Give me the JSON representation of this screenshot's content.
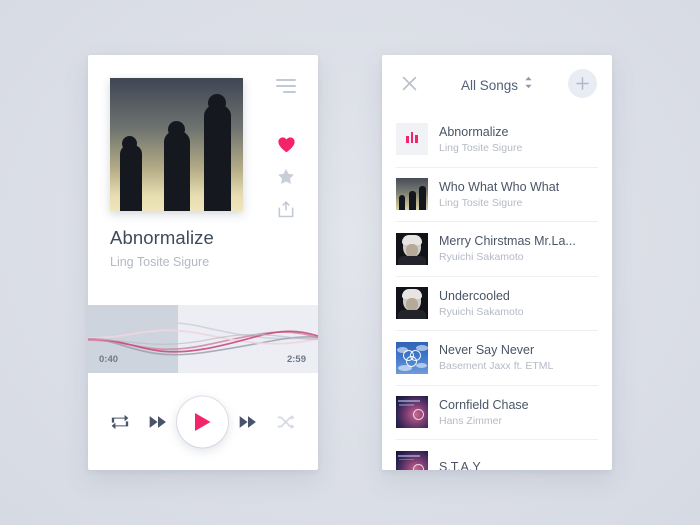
{
  "theme": {
    "page_background": "#dcdfe7",
    "accent_pink": "#f4246b",
    "card_white": "#ffffff",
    "text_dark": "#4a5566",
    "text_muted": "#b4bac5",
    "waveform_track": "#eceef4",
    "waveform_played": "#cdd4de"
  },
  "player": {
    "menu_icon": "hamburger-icon",
    "album_art_alt": "album-artwork",
    "actions": [
      {
        "name": "like",
        "icon": "heart-icon",
        "active": true
      },
      {
        "name": "favorite",
        "icon": "star-icon",
        "active": false
      },
      {
        "name": "share",
        "icon": "share-icon",
        "active": false
      }
    ],
    "now_playing": {
      "title": "Abnormalize",
      "artist": "Ling Tosite Sigure"
    },
    "progress": {
      "current_time": "0:40",
      "total_time": "2:59",
      "percent": 39
    },
    "controls": [
      {
        "name": "repeat",
        "icon": "repeat-icon"
      },
      {
        "name": "previous",
        "icon": "fast-backward-icon"
      },
      {
        "name": "play",
        "icon": "play-icon"
      },
      {
        "name": "next",
        "icon": "fast-forward-icon"
      },
      {
        "name": "shuffle",
        "icon": "shuffle-icon"
      }
    ]
  },
  "playlist": {
    "close_icon": "close-icon",
    "title": "All Songs",
    "sort_icon": "sort-chevron-icon",
    "add_icon": "plus-icon",
    "songs": [
      {
        "title": "Abnormalize",
        "artist": "Ling Tosite Sigure",
        "art": "eq",
        "playing": true
      },
      {
        "title": "Who What Who What",
        "artist": "Ling Tosite Sigure",
        "art": "band",
        "playing": false
      },
      {
        "title": "Merry Chirstmas Mr.La...",
        "artist": "Ryuichi Sakamoto",
        "art": "portrait",
        "playing": false
      },
      {
        "title": "Undercooled",
        "artist": "Ryuichi Sakamoto",
        "art": "portrait",
        "playing": false
      },
      {
        "title": "Never Say Never",
        "artist": "Basement Jaxx ft. ETML",
        "art": "sky",
        "playing": false
      },
      {
        "title": "Cornfield Chase",
        "artist": "Hans Zimmer",
        "art": "space",
        "playing": false
      },
      {
        "title": "S.T.A.Y",
        "artist": "",
        "art": "space",
        "playing": false
      }
    ]
  }
}
